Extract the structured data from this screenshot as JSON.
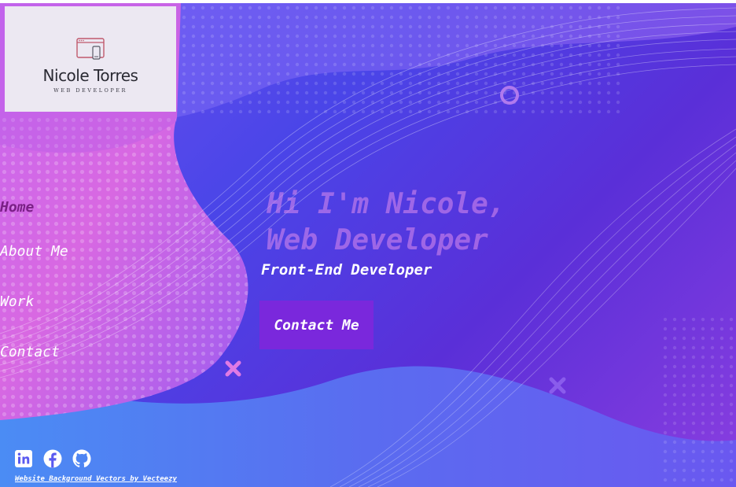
{
  "logo": {
    "name": "Nicole Torres",
    "subtitle": "WEB DEVELOPER"
  },
  "nav": {
    "items": [
      {
        "label": "Home",
        "active": true
      },
      {
        "label": "About Me",
        "active": false
      },
      {
        "label": "Work",
        "active": false
      },
      {
        "label": "Contact",
        "active": false
      }
    ]
  },
  "hero": {
    "line1": "Hi I'm Nicole,",
    "line2": "Web Developer",
    "subtitle": "Front-End Developer",
    "cta_label": "Contact Me"
  },
  "footer": {
    "socials": [
      {
        "icon": "linkedin-icon"
      },
      {
        "icon": "facebook-icon"
      },
      {
        "icon": "github-icon"
      }
    ],
    "credit": "Website Background Vectors by Vecteezy"
  },
  "colors": {
    "background_start": "#6e52f0",
    "background_mid": "#4a45e8",
    "background_end": "#8a3ee0",
    "pink_wave": "#e070e0",
    "active_nav": "#7a1f86",
    "button": "#7a28dc",
    "hero_title": "#cd82eb",
    "logo_card": "#ece8f2"
  }
}
